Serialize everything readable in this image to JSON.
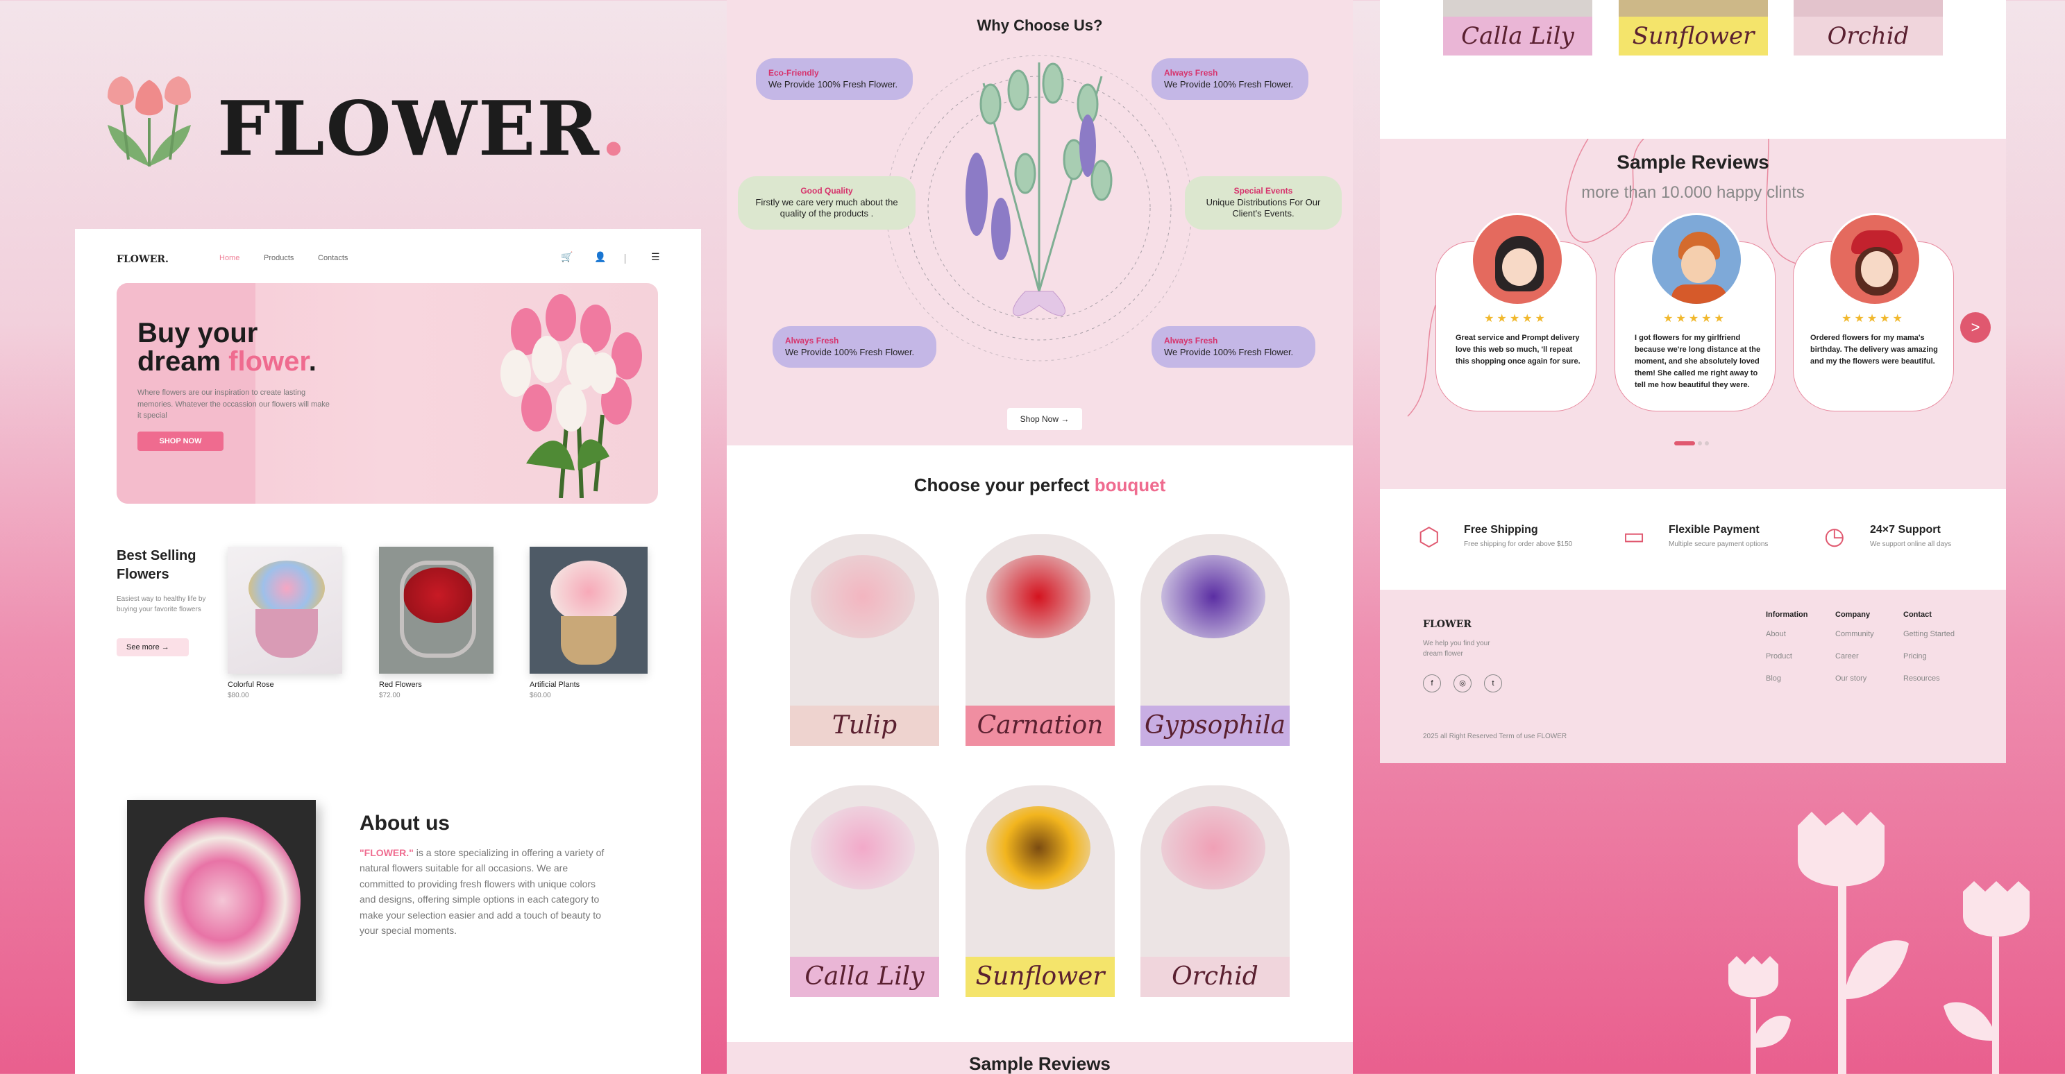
{
  "brand": {
    "name": "FLOWER",
    "dot": "."
  },
  "site": {
    "nav": {
      "logo": "FLOWER.",
      "links": [
        "Home",
        "Products",
        "Contacts"
      ]
    },
    "hero": {
      "line1": "Buy your",
      "line2a": "dream ",
      "line2b": "flower",
      "line2c": ".",
      "desc": "Where flowers are our inspiration to create lasting memories. Whatever the occassion our flowers will make it special",
      "cta": "SHOP NOW"
    },
    "best": {
      "title": "Best Selling Flowers",
      "desc": "Easiest way to healthy life by buying your favorite flowers",
      "cta": "See more",
      "items": [
        {
          "name": "Colorful Rose",
          "price": "$80.00"
        },
        {
          "name": "Red Flowers",
          "price": "$72.00"
        },
        {
          "name": "Artificial Plants",
          "price": "$60.00"
        }
      ]
    },
    "about": {
      "title": "About us",
      "brand": "\"FLOWER.\"",
      "text": " is a store specializing in offering a variety of natural flowers suitable for all occasions. We are committed to providing fresh flowers with unique colors and designs, offering simple options in each category to make your selection easier and add a touch of beauty to your special moments."
    }
  },
  "why": {
    "title": "Why Choose Us?",
    "pills": [
      {
        "t": "Eco-Friendly",
        "d": "We Provide 100% Fresh Flower."
      },
      {
        "t": "Always Fresh",
        "d": "We Provide 100% Fresh Flower."
      },
      {
        "t": "Good Quality",
        "d": "Firstly we care very much about the quality of the products ."
      },
      {
        "t": "Special Events",
        "d": "Unique Distributions For Our Client's Events."
      },
      {
        "t": "Always Fresh",
        "d": "We Provide 100% Fresh Flower."
      },
      {
        "t": "Always Fresh",
        "d": "We Provide 100% Fresh Flower."
      }
    ],
    "cta": "Shop Now"
  },
  "bouquet": {
    "title": "Choose your perfect ",
    "title_accent": "bouquet",
    "items": [
      "Tulip",
      "Carnation",
      "Gypsophila",
      "Calla Lily",
      "Sunflower",
      "Orchid"
    ],
    "colors": [
      "#eed3cf",
      "#f08ea1",
      "#c8aee3",
      "#eab6d6",
      "#f4e46b",
      "#f0d5dc"
    ]
  },
  "reviews": {
    "title": "Sample Reviews",
    "sub": "more than 10.000 happy clints",
    "stars": "★★★★★",
    "items": [
      "Great service and Prompt delivery love this web so much, 'll repeat this shopping once again for sure.",
      "I got flowers for my girlfriend because we're long distance at the moment, and she absolutely loved them! She called me right away to tell me how beautiful they were.",
      "Ordered flowers for my mama's birthday. The delivery was amazing and my the flowers were beautiful."
    ],
    "next": ">"
  },
  "features": [
    {
      "t": "Free Shipping",
      "d": "Free shipping for order above $150"
    },
    {
      "t": "Flexible Payment",
      "d": "Multiple secure payment options"
    },
    {
      "t": "24×7 Support",
      "d": "We support online all days"
    }
  ],
  "footer": {
    "logo": "FLOWER",
    "tag": "We help you find your dream flower",
    "cols": [
      {
        "h": "Information",
        "l": [
          "About",
          "Product",
          "Blog"
        ]
      },
      {
        "h": "Company",
        "l": [
          "Community",
          "Career",
          "Our story"
        ]
      },
      {
        "h": "Contact",
        "l": [
          "Getting Started",
          "Pricing",
          "Resources"
        ]
      }
    ],
    "copy": "2025 all Right Reserved Term of use FLOWER"
  }
}
